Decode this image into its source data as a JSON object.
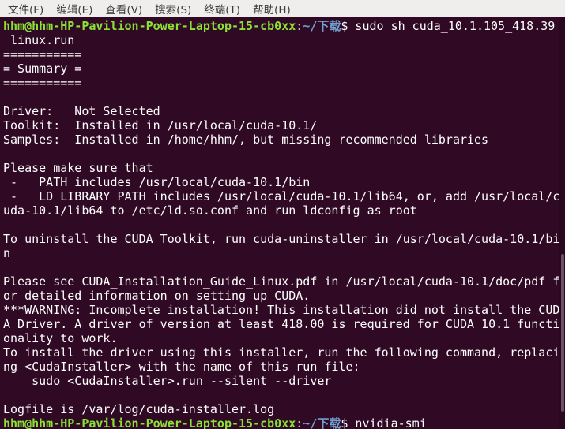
{
  "menu": [
    {
      "label": "文件(F)"
    },
    {
      "label": "编辑(E)"
    },
    {
      "label": "查看(V)"
    },
    {
      "label": "搜索(S)"
    },
    {
      "label": "终端(T)"
    },
    {
      "label": "帮助(H)"
    }
  ],
  "prompt": {
    "user": "hhm@hhm-HP-Pavilion-Power-Laptop-15-cb0xx",
    "path": "~/下载",
    "symbol": "$"
  },
  "colors": {
    "background": "#300a24",
    "prompt_user": "#8ae234",
    "prompt_path": "#729fcf",
    "text": "#ffffff"
  },
  "lines": [
    {
      "type": "prompt",
      "command": " sudo sh cuda_10.1.105_418.39"
    },
    {
      "type": "text",
      "text": "_linux.run"
    },
    {
      "type": "text",
      "text": "==========="
    },
    {
      "type": "text",
      "text": "= Summary ="
    },
    {
      "type": "text",
      "text": "==========="
    },
    {
      "type": "text",
      "text": ""
    },
    {
      "type": "text",
      "text": "Driver:   Not Selected"
    },
    {
      "type": "text",
      "text": "Toolkit:  Installed in /usr/local/cuda-10.1/"
    },
    {
      "type": "text",
      "text": "Samples:  Installed in /home/hhm/, but missing recommended libraries"
    },
    {
      "type": "text",
      "text": ""
    },
    {
      "type": "text",
      "text": "Please make sure that"
    },
    {
      "type": "text",
      "text": " -   PATH includes /usr/local/cuda-10.1/bin"
    },
    {
      "type": "text",
      "text": " -   LD_LIBRARY_PATH includes /usr/local/cuda-10.1/lib64, or, add /usr/local/c"
    },
    {
      "type": "text",
      "text": "uda-10.1/lib64 to /etc/ld.so.conf and run ldconfig as root"
    },
    {
      "type": "text",
      "text": ""
    },
    {
      "type": "text",
      "text": "To uninstall the CUDA Toolkit, run cuda-uninstaller in /usr/local/cuda-10.1/bi"
    },
    {
      "type": "text",
      "text": "n"
    },
    {
      "type": "text",
      "text": ""
    },
    {
      "type": "text",
      "text": "Please see CUDA_Installation_Guide_Linux.pdf in /usr/local/cuda-10.1/doc/pdf f"
    },
    {
      "type": "text",
      "text": "or detailed information on setting up CUDA."
    },
    {
      "type": "text",
      "text": "***WARNING: Incomplete installation! This installation did not install the CUD"
    },
    {
      "type": "text",
      "text": "A Driver. A driver of version at least 418.00 is required for CUDA 10.1 functi"
    },
    {
      "type": "text",
      "text": "onality to work."
    },
    {
      "type": "text",
      "text": "To install the driver using this installer, run the following command, replaci"
    },
    {
      "type": "text",
      "text": "ng <CudaInstaller> with the name of this run file:"
    },
    {
      "type": "text",
      "text": "    sudo <CudaInstaller>.run --silent --driver"
    },
    {
      "type": "text",
      "text": ""
    },
    {
      "type": "text",
      "text": "Logfile is /var/log/cuda-installer.log"
    },
    {
      "type": "prompt",
      "command": " nvidia-smi"
    }
  ]
}
